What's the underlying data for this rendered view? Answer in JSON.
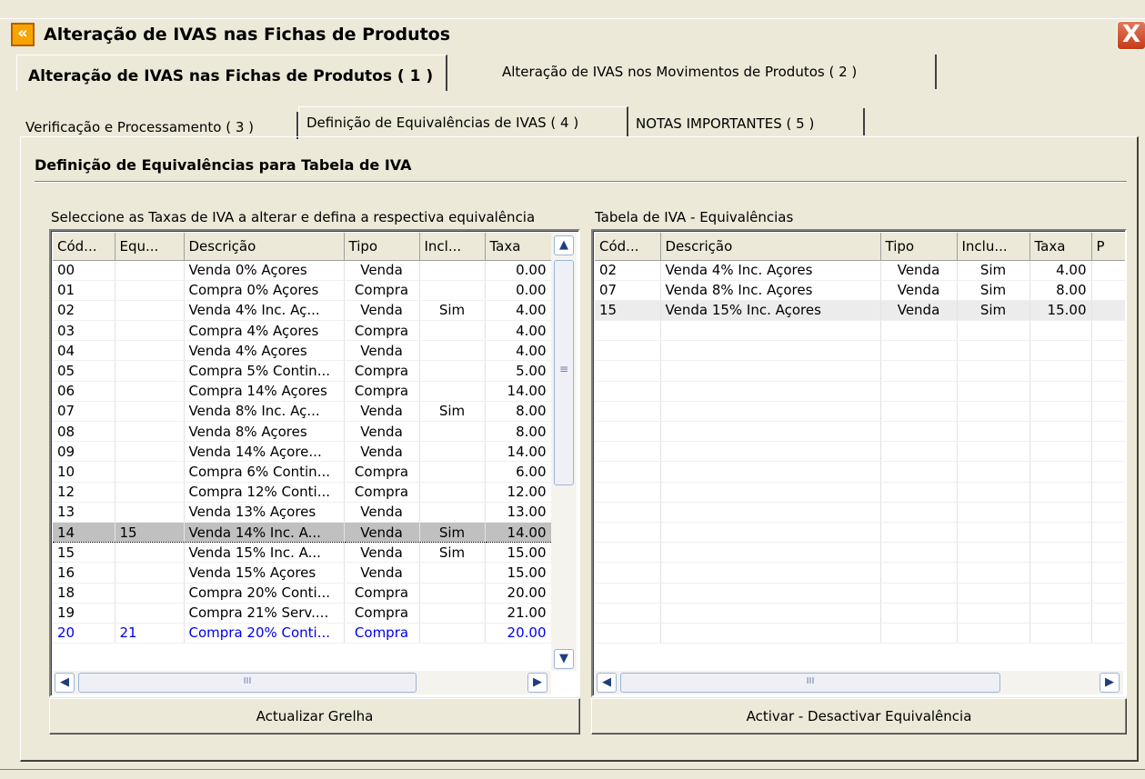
{
  "window": {
    "title": "Alteração de IVAS nas Fichas de Produtos",
    "close_label": "X"
  },
  "top_tabs": [
    {
      "label": "Alteração de IVAS nas Fichas de Produtos ( 1 )"
    },
    {
      "label": "Alteração de IVAS nos Movimentos de Produtos ( 2 )"
    }
  ],
  "sub_tabs": [
    {
      "label": "Verificação e Processamento ( 3 )"
    },
    {
      "label": "Definição de Equivalências de IVAS ( 4 )"
    },
    {
      "label": "NOTAS IMPORTANTES ( 5 )"
    }
  ],
  "section": {
    "title": "Definição de Equivalências para Tabela de IVA"
  },
  "left_grid": {
    "caption": "Seleccione as Taxas de IVA a alterar e defina a respectiva equivalência",
    "columns": [
      "Cód...",
      "Equ...",
      "Descrição",
      "Tipo",
      "Incl...",
      "Taxa"
    ],
    "rows": [
      [
        "00",
        "",
        "Venda 0% Açores",
        "Venda",
        "",
        "0.00"
      ],
      [
        "01",
        "",
        "Compra 0% Açores",
        "Compra",
        "",
        "0.00"
      ],
      [
        "02",
        "",
        "Venda 4% Inc. Aç...",
        "Venda",
        "Sim",
        "4.00"
      ],
      [
        "03",
        "",
        "Compra 4% Açores",
        "Compra",
        "",
        "4.00"
      ],
      [
        "04",
        "",
        "Venda 4% Açores",
        "Venda",
        "",
        "4.00"
      ],
      [
        "05",
        "",
        "Compra 5% Contin...",
        "Compra",
        "",
        "5.00"
      ],
      [
        "06",
        "",
        "Compra 14% Açores",
        "Compra",
        "",
        "14.00"
      ],
      [
        "07",
        "",
        "Venda 8% Inc. Aç...",
        "Venda",
        "Sim",
        "8.00"
      ],
      [
        "08",
        "",
        "Venda 8% Açores",
        "Venda",
        "",
        "8.00"
      ],
      [
        "09",
        "",
        "Venda 14% Açore...",
        "Venda",
        "",
        "14.00"
      ],
      [
        "10",
        "",
        "Compra 6% Contin...",
        "Compra",
        "",
        "6.00"
      ],
      [
        "12",
        "",
        "Compra 12% Conti...",
        "Compra",
        "",
        "12.00"
      ],
      [
        "13",
        "",
        "Venda 13% Açores",
        "Venda",
        "",
        "13.00"
      ],
      [
        "14",
        "15",
        "Venda 14% Inc. A...",
        "Venda",
        "Sim",
        "14.00"
      ],
      [
        "15",
        "",
        "Venda 15% Inc. A...",
        "Venda",
        "Sim",
        "15.00"
      ],
      [
        "16",
        "",
        "Venda 15% Açores",
        "Venda",
        "",
        "15.00"
      ],
      [
        "18",
        "",
        "Compra 20% Conti...",
        "Compra",
        "",
        "20.00"
      ],
      [
        "19",
        "",
        "Compra 21% Serv....",
        "Compra",
        "",
        "21.00"
      ],
      [
        "20",
        "21",
        "Compra 20% Conti...",
        "Compra",
        "",
        "20.00"
      ]
    ],
    "selected_row": 13,
    "blue_row": 18,
    "button": {
      "label": "Actualizar Grelha"
    }
  },
  "right_grid": {
    "caption": "Tabela de IVA - Equivalências",
    "columns": [
      "Cód...",
      "Descrição",
      "Tipo",
      "Inclu...",
      "Taxa",
      "P"
    ],
    "rows": [
      [
        "02",
        "Venda 4% Inc. Açores",
        "Venda",
        "Sim",
        "4.00",
        ""
      ],
      [
        "07",
        "Venda 8% Inc. Açores",
        "Venda",
        "Sim",
        "8.00",
        ""
      ],
      [
        "15",
        "Venda 15% Inc. Açores",
        "Venda",
        "Sim",
        "15.00",
        ""
      ]
    ],
    "highlight_row": 2,
    "button": {
      "label": "Activar - Desactivar Equivalência"
    }
  },
  "scrollbar_icons": {
    "up": "▲",
    "down": "▼",
    "left": "◀",
    "right": "▶",
    "grip_v": "≡",
    "grip_h": "III"
  }
}
